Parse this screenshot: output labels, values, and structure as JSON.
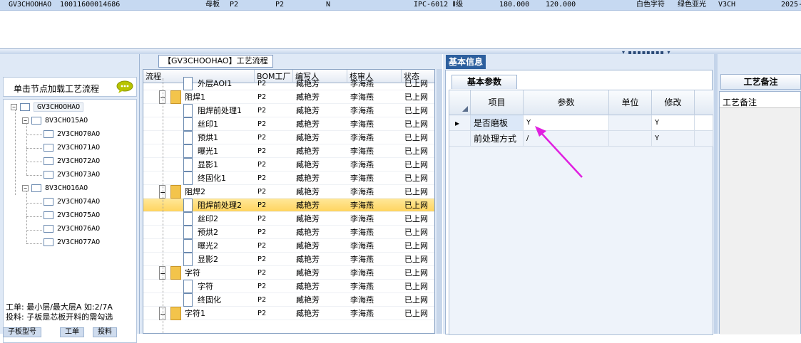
{
  "top_row": {
    "code": "GV3CHOOHAO",
    "number": "10011600014686",
    "type": "母板",
    "p1": "P2",
    "p2": "P2",
    "flag": "N",
    "standard": "IPC-6012 Ⅱ级",
    "val1": "180.000",
    "val2": "120.000",
    "char_color": "白色字符",
    "mask_color": "绿色亚光",
    "code2": "V3CH",
    "date": "2025-"
  },
  "grip": "▾ ▪▪▪▪▪▪▪▪ ▾",
  "left": {
    "header": "单击节点加载工艺流程",
    "tree": {
      "root": "GV3CHOOHAO",
      "groups": [
        {
          "label": "8V3CHO15AO",
          "children": [
            "2V3CHO70AO",
            "2V3CHO71AO",
            "2V3CHO72AO",
            "2V3CHO73AO"
          ]
        },
        {
          "label": "8V3CHO16AO",
          "children": [
            "2V3CHO74AO",
            "2V3CHO75AO",
            "2V3CHO76AO",
            "2V3CHO77AO"
          ]
        }
      ]
    },
    "note1": "工单: 最小层/最大层A 如:2/7A",
    "note2": "投料: 子板是芯板开料的需勾选",
    "tabs": [
      "子板型号",
      "工单",
      "投料"
    ]
  },
  "middle": {
    "title": "【GV3CHOOHAO】工艺流程",
    "columns": [
      "流程",
      "BOM工厂",
      "编写人",
      "核审人",
      "状态"
    ],
    "rows": [
      {
        "name": "外层AOI1",
        "factory": "P2",
        "writer": "臧艳芳",
        "reviewer": "李海燕",
        "status": "已上网"
      },
      {
        "name": "阻焊1",
        "factory": "P2",
        "writer": "臧艳芳",
        "reviewer": "李海燕",
        "status": "已上网"
      },
      {
        "name": "阻焊前处理1",
        "factory": "P2",
        "writer": "臧艳芳",
        "reviewer": "李海燕",
        "status": "已上网"
      },
      {
        "name": "丝印1",
        "factory": "P2",
        "writer": "臧艳芳",
        "reviewer": "李海燕",
        "status": "已上网"
      },
      {
        "name": "预烘1",
        "factory": "P2",
        "writer": "臧艳芳",
        "reviewer": "李海燕",
        "status": "已上网"
      },
      {
        "name": "曝光1",
        "factory": "P2",
        "writer": "臧艳芳",
        "reviewer": "李海燕",
        "status": "已上网"
      },
      {
        "name": "显影1",
        "factory": "P2",
        "writer": "臧艳芳",
        "reviewer": "李海燕",
        "status": "已上网"
      },
      {
        "name": "终固化1",
        "factory": "P2",
        "writer": "臧艳芳",
        "reviewer": "李海燕",
        "status": "已上网"
      },
      {
        "name": "阻焊2",
        "factory": "P2",
        "writer": "臧艳芳",
        "reviewer": "李海燕",
        "status": "已上网"
      },
      {
        "name": "阻焊前处理2",
        "factory": "P2",
        "writer": "臧艳芳",
        "reviewer": "李海燕",
        "status": "已上网"
      },
      {
        "name": "丝印2",
        "factory": "P2",
        "writer": "臧艳芳",
        "reviewer": "李海燕",
        "status": "已上网"
      },
      {
        "name": "预烘2",
        "factory": "P2",
        "writer": "臧艳芳",
        "reviewer": "李海燕",
        "status": "已上网"
      },
      {
        "name": "曝光2",
        "factory": "P2",
        "writer": "臧艳芳",
        "reviewer": "李海燕",
        "status": "已上网"
      },
      {
        "name": "显影2",
        "factory": "P2",
        "writer": "臧艳芳",
        "reviewer": "李海燕",
        "status": "已上网"
      },
      {
        "name": "字符",
        "factory": "P2",
        "writer": "臧艳芳",
        "reviewer": "李海燕",
        "status": "已上网"
      },
      {
        "name": "字符",
        "factory": "P2",
        "writer": "臧艳芳",
        "reviewer": "李海燕",
        "status": "已上网"
      },
      {
        "name": "终固化",
        "factory": "P2",
        "writer": "臧艳芳",
        "reviewer": "李海燕",
        "status": "已上网"
      },
      {
        "name": "字符1",
        "factory": "P2",
        "writer": "臧艳芳",
        "reviewer": "李海燕",
        "status": "已上网"
      }
    ],
    "selected_row": 9,
    "folder_rows": [
      1,
      8,
      14,
      17
    ],
    "highlight_color": "#ffd45f"
  },
  "basic_info": {
    "tab": "基本信息",
    "subtab": "基本参数",
    "columns": [
      "项目",
      "参数",
      "单位",
      "修改"
    ],
    "rows": [
      {
        "item": "是否磨板",
        "param": "Y",
        "unit": "",
        "modify": "Y"
      },
      {
        "item": "前处理方式",
        "param": "/",
        "unit": "",
        "modify": "Y"
      }
    ],
    "arrow_color": "#e020e0"
  },
  "remarks": {
    "tab": "工艺备注",
    "label": "工艺备注"
  }
}
